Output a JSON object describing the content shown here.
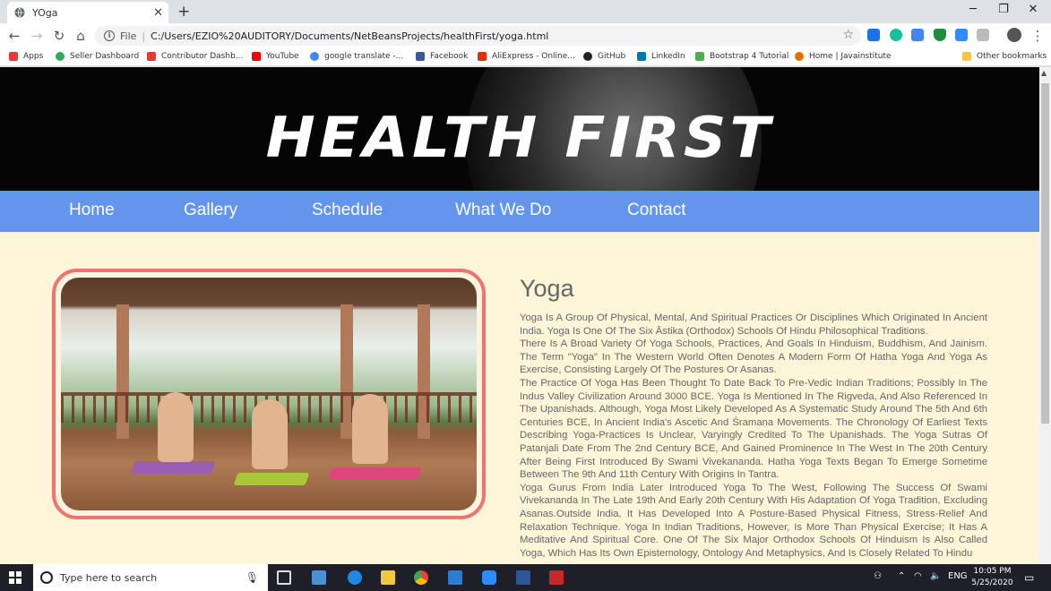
{
  "browser": {
    "tab_title": "YOga",
    "tab_close": "✕",
    "new_tab": "+",
    "window_controls": {
      "minimize": "─",
      "maximize": "❐",
      "close": "✕"
    },
    "url_scheme": "File",
    "url_path": "C:/Users/EZIO%20AUDITORY/Documents/NetBeansProjects/healthFirst/yoga.html",
    "bookmarks": [
      {
        "label": "Apps",
        "icon": "apps-grid-icon",
        "color": "#e53935"
      },
      {
        "label": "Seller Dashboard",
        "icon": "seller-icon",
        "color": "#34a853"
      },
      {
        "label": "Contributor Dashb...",
        "icon": "shutterstock-icon",
        "color": "#e53935"
      },
      {
        "label": "YouTube",
        "icon": "youtube-icon",
        "color": "#ff0000"
      },
      {
        "label": "google translate -...",
        "icon": "google-icon",
        "color": "#4285f4"
      },
      {
        "label": "Facebook",
        "icon": "facebook-icon",
        "color": "#3b5998"
      },
      {
        "label": "AliExpress - Online...",
        "icon": "aliexpress-icon",
        "color": "#e62e04"
      },
      {
        "label": "GitHub",
        "icon": "github-icon",
        "color": "#222222"
      },
      {
        "label": "LinkedIn",
        "icon": "linkedin-icon",
        "color": "#0077b5"
      },
      {
        "label": "Bootstrap 4 Tutorial",
        "icon": "w3schools-icon",
        "color": "#4caf50"
      },
      {
        "label": "Home | Javainstitute",
        "icon": "java-icon",
        "color": "#e76f00"
      }
    ],
    "other_bookmarks": "Other bookmarks"
  },
  "site": {
    "hero_title": "HEALTH  FIRST",
    "menu": [
      "Home",
      "Gallery",
      "Schedule",
      "What We Do",
      "Contact"
    ],
    "article": {
      "title": "Yoga",
      "paragraphs": [
        "Yoga Is A Group Of Physical, Mental, And Spiritual Practices Or Disciplines Which Originated In Ancient India. Yoga Is One Of The Six Āstika (Orthodox) Schools Of Hindu Philosophical Traditions.",
        "There Is A Broad Variety Of Yoga Schools, Practices, And Goals In Hinduism, Buddhism, And Jainism. The Term \"Yoga\" In The Western World Often Denotes A Modern Form Of Hatha Yoga And Yoga As Exercise, Consisting Largely Of The Postures Or Asanas.",
        "The Practice Of Yoga Has Been Thought To Date Back To Pre-Vedic Indian Traditions; Possibly In The Indus Valley Civilization Around 3000 BCE. Yoga Is Mentioned In The Rigveda, And Also Referenced In The Upanishads. Although, Yoga Most Likely Developed As A Systematic Study Around The 5th And 6th Centuries BCE, In Ancient India's Ascetic And Śramaṇa Movements. The Chronology Of Earliest Texts Describing Yoga-Practices Is Unclear, Varyingly Credited To The Upanishads. The Yoga Sutras Of Patanjali Date From The 2nd Century BCE, And Gained Prominence In The West In The 20th Century After Being First Introduced By Swami Vivekananda. Hatha Yoga Texts Began To Emerge Sometime Between The 9th And 11th Century With Origins In Tantra.",
        "Yoga Gurus From India Later Introduced Yoga To The West, Following The Success Of Swami Vivekananda In The Late 19th And Early 20th Century With His Adaptation Of Yoga Tradition, Excluding Asanas.Outside India, It Has Developed Into A Posture-Based Physical Fitness, Stress-Relief And Relaxation Technique. Yoga In Indian Traditions, However, Is More Than Physical Exercise; It Has A Meditative And Spiritual Core. One Of The Six Major Orthodox Schools Of Hinduism Is Also Called Yoga, Which Has Its Own Epistemology, Ontology And Metaphysics, And Is Closely Related To Hindu"
      ]
    },
    "colors": {
      "menu_bg": "#6495ed",
      "page_bg": "#fff5d9",
      "frame": "#f0736f",
      "hero_bg": "#050505"
    }
  },
  "taskbar": {
    "search_placeholder": "Type here to search",
    "language": "ENG",
    "time": "10:05 PM",
    "date": "5/25/2020"
  }
}
